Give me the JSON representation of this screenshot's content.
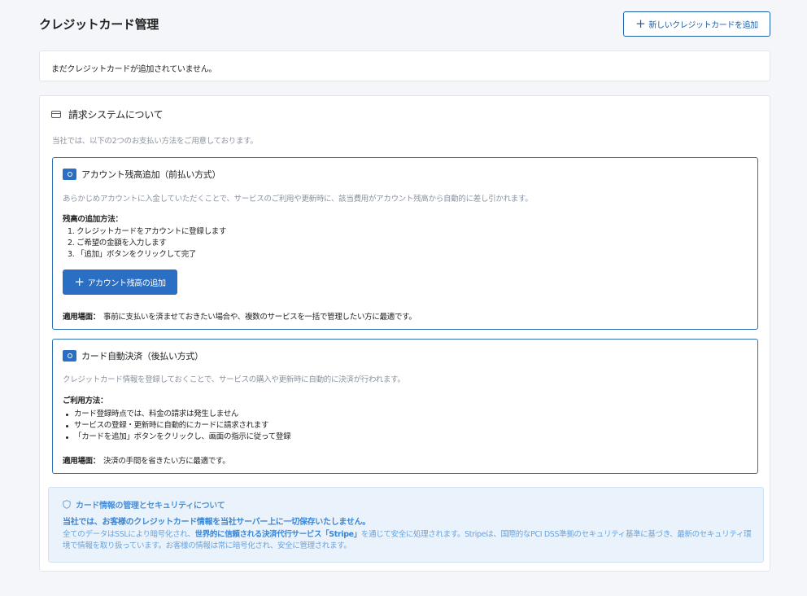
{
  "header": {
    "title": "クレジットカード管理",
    "add_card_label": "新しいクレジットカードを追加"
  },
  "empty_state": "まだクレジットカードが追加されていません。",
  "billing": {
    "heading": "請求システムについて",
    "intro": "当社では、以下の2つのお支払い方法をご用意しております。",
    "methods": [
      {
        "title": "アカウント残高追加（前払い方式）",
        "description": "あらかじめアカウントに入金していただくことで、サービスのご利用や更新時に、該当費用がアカウント残高から自動的に差し引かれます。",
        "subheading": "残高の追加方法：",
        "steps": [
          "1. クレジットカードをアカウントに登録します",
          "2. ご希望の金額を入力します",
          "3. 「追加」ボタンをクリックして完了"
        ],
        "button_label": "アカウント残高の追加",
        "use_label": "適用場面：",
        "use_text": "事前に支払いを済ませておきたい場合や、複数のサービスを一括で管理したい方に最適です。"
      },
      {
        "title": "カード自動決済（後払い方式）",
        "description": "クレジットカード情報を登録しておくことで、サービスの購入や更新時に自動的に決済が行われます。",
        "subheading": "ご利用方法：",
        "steps": [
          "カード登録時点では、料金の請求は発生しません",
          "サービスの登録・更新時に自動的にカードに請求されます",
          "「カードを追加」ボタンをクリックし、画面の指示に従って登録"
        ],
        "use_label": "適用場面：",
        "use_text": "決済の手間を省きたい方に最適です。"
      }
    ],
    "security": {
      "title": "カード情報の管理とセキュリティについて",
      "lead": "当社では、お客様のクレジットカード情報を当社サーバー上に一切保存いたしません。",
      "body_part1": "全てのデータはSSLにより暗号化され、",
      "body_bold": "世界的に信頼される決済代行サービス「Stripe」",
      "body_part2": "を通じて安全に処理されます。Stripeは、国際的なPCI DSS準拠のセキュリティ基準に基づき、最新のセキュリティ環境で情報を取り扱っています。お客様の情報は常に暗号化され、安全に管理されます。"
    }
  },
  "colors": {
    "accent": "#2b6fc4",
    "border_accent": "#2d6fb5",
    "security_bg": "#eaf3fb",
    "security_text": "#3a86d6"
  }
}
